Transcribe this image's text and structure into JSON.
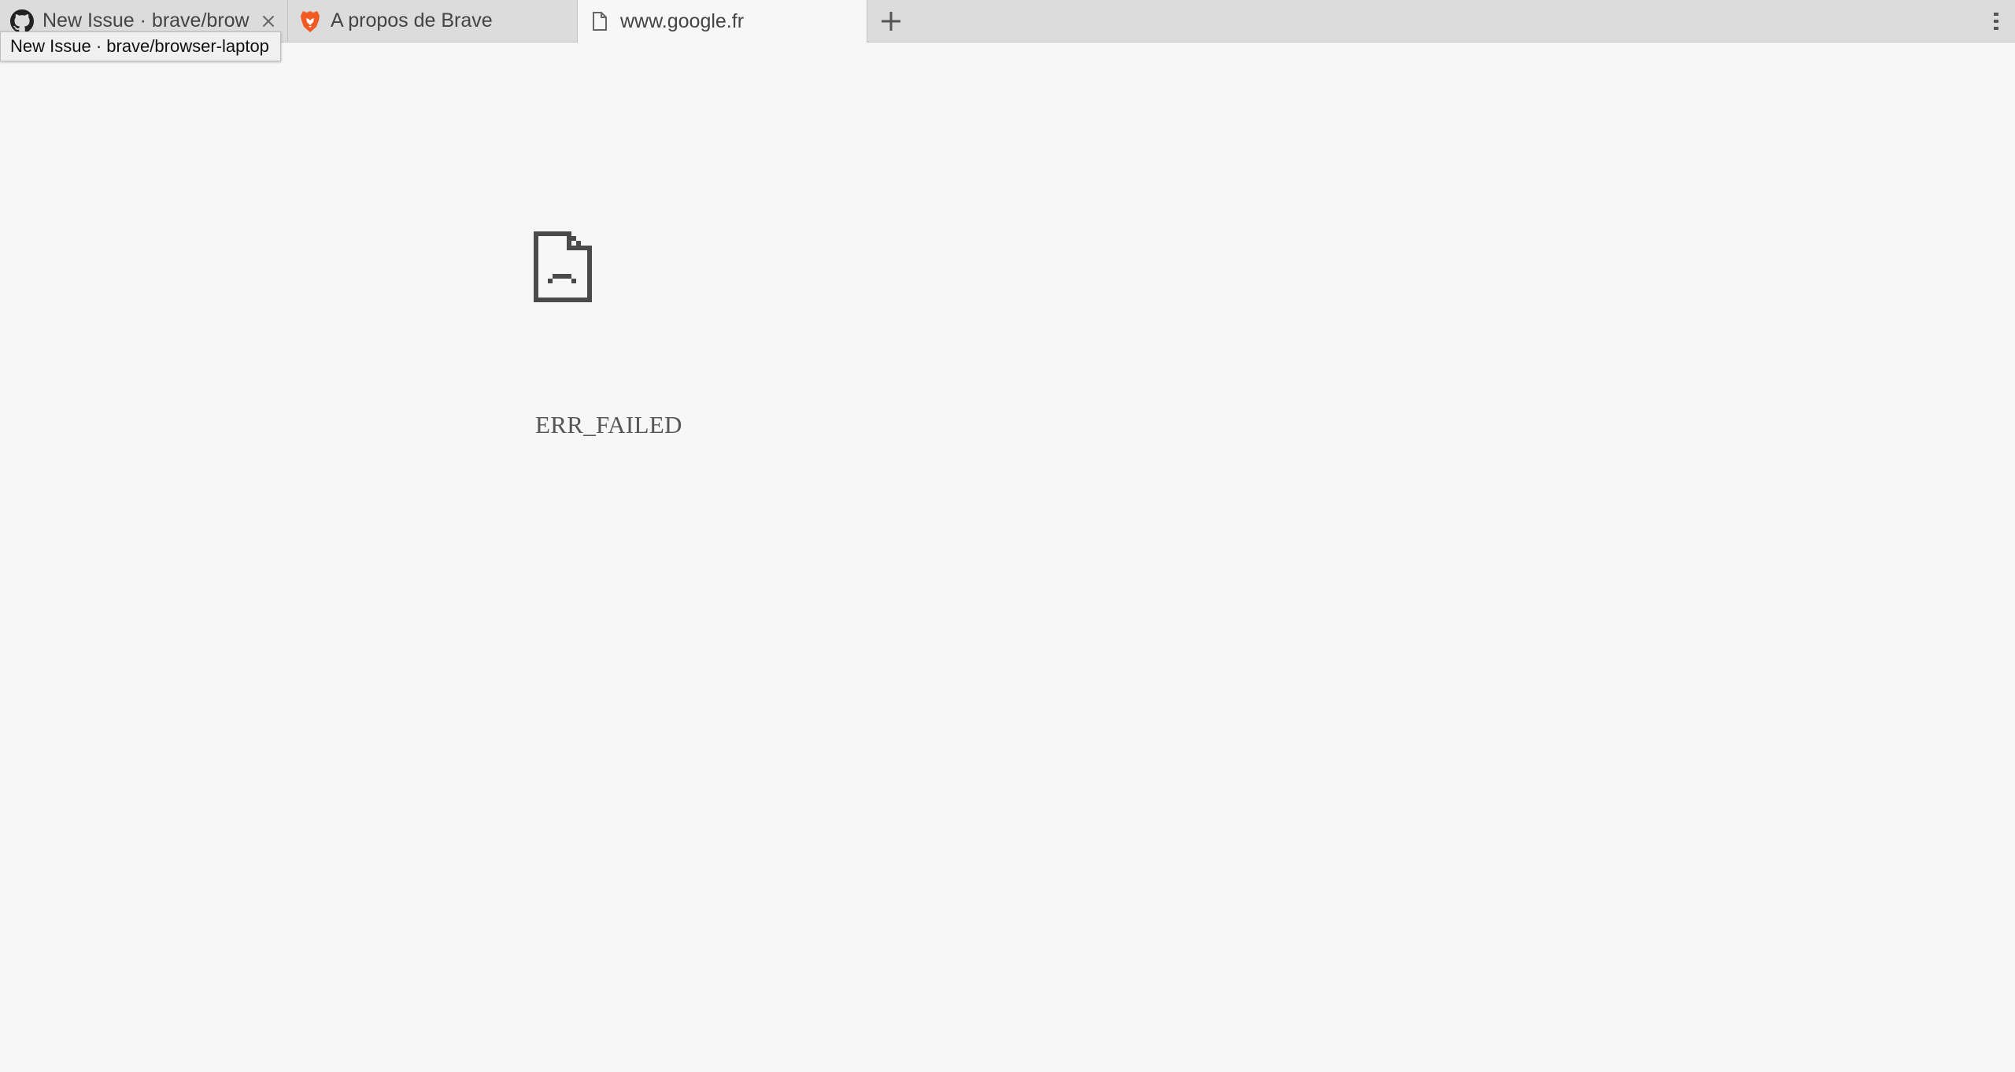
{
  "tabs": [
    {
      "title": "New Issue · brave/brow",
      "icon": "github-icon",
      "close_label": "×"
    },
    {
      "title": "A propos de Brave",
      "icon": "brave-lion-icon"
    },
    {
      "title": "www.google.fr",
      "icon": "page-icon"
    }
  ],
  "new_tab_label": "+",
  "tooltip": "New Issue · brave/browser-laptop",
  "error": {
    "code": "ERR_FAILED",
    "icon": "sad-page-icon"
  },
  "colors": {
    "tabstrip": "#dcdcdc",
    "page_background": "#f7f7f7",
    "brave_orange": "#f15a22",
    "error_text": "#555555"
  }
}
